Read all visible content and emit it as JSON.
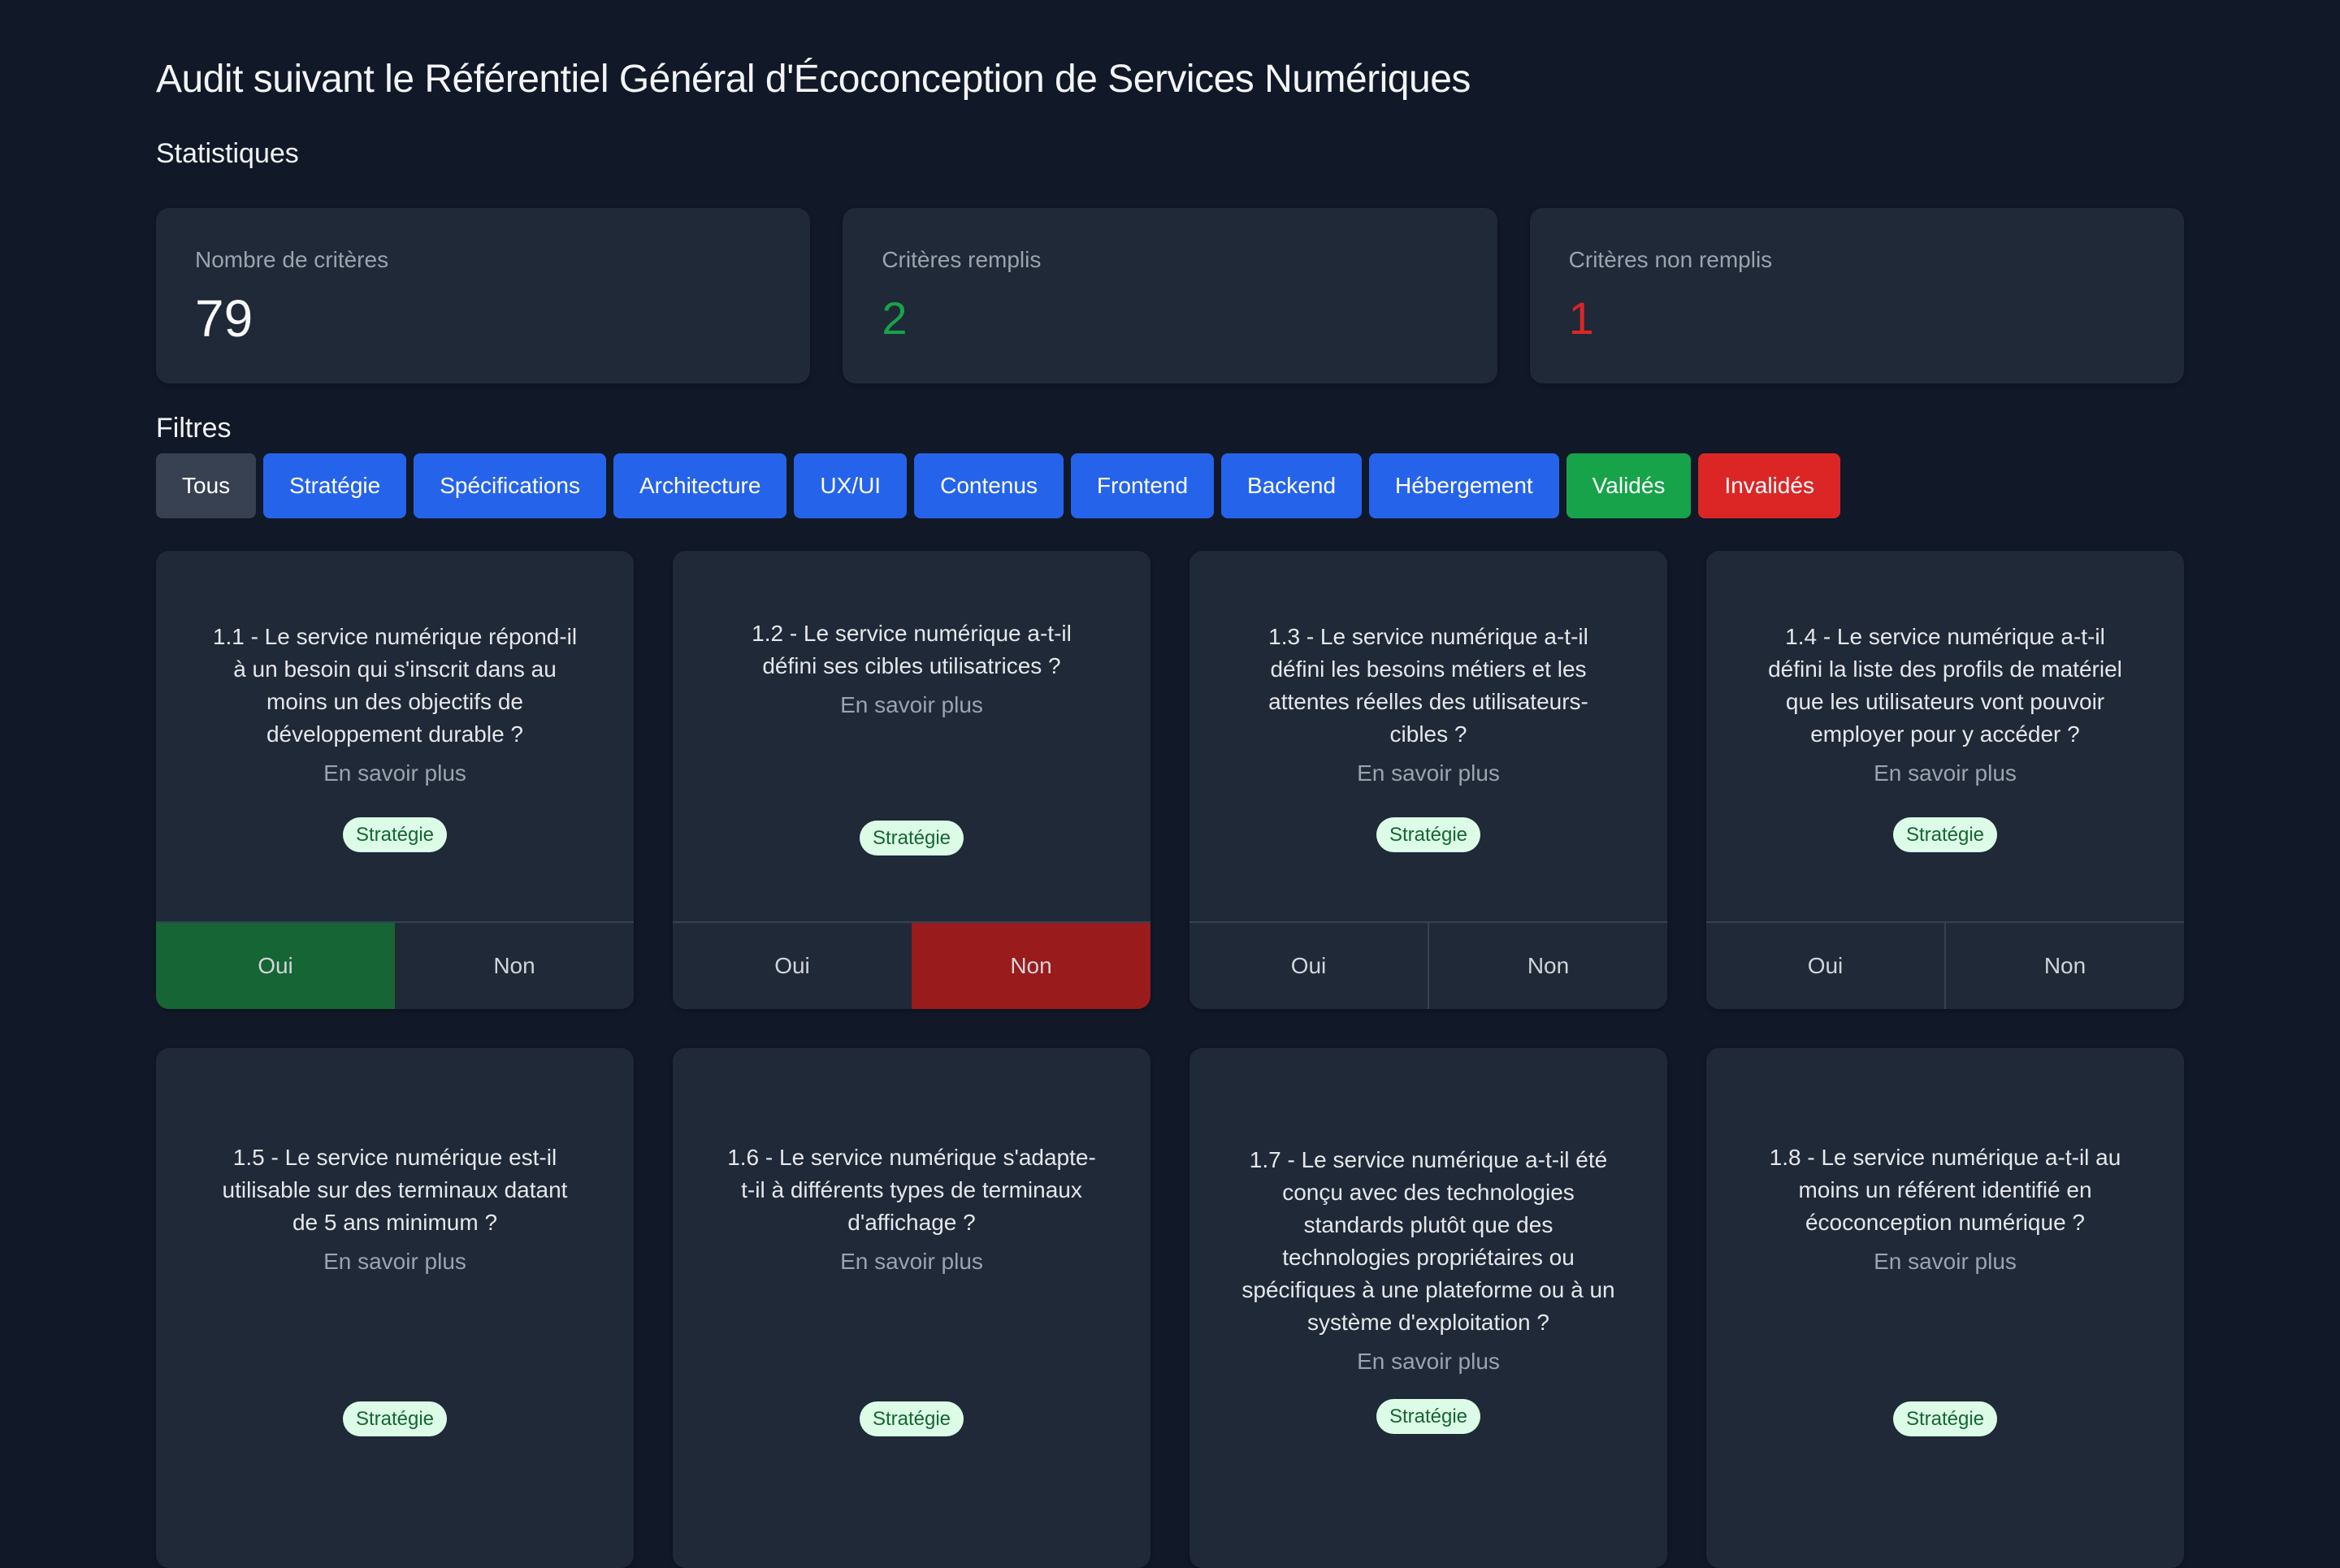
{
  "header": {
    "title": "Audit suivant le Référentiel Général d'Écoconception de Services Numériques"
  },
  "stats": {
    "section_title": "Statistiques",
    "items": [
      {
        "label": "Nombre de critères",
        "value": "79"
      },
      {
        "label": "Critères remplis",
        "value": "2"
      },
      {
        "label": "Critères non remplis",
        "value": "1"
      }
    ]
  },
  "filters": {
    "section_title": "Filtres",
    "buttons": [
      {
        "label": "Tous",
        "style": "neutral"
      },
      {
        "label": "Stratégie",
        "style": "blue"
      },
      {
        "label": "Spécifications",
        "style": "blue"
      },
      {
        "label": "Architecture",
        "style": "blue"
      },
      {
        "label": "UX/UI",
        "style": "blue"
      },
      {
        "label": "Contenus",
        "style": "blue"
      },
      {
        "label": "Frontend",
        "style": "blue"
      },
      {
        "label": "Backend",
        "style": "blue"
      },
      {
        "label": "Hébergement",
        "style": "blue"
      },
      {
        "label": "Validés",
        "style": "green"
      },
      {
        "label": "Invalidés",
        "style": "red"
      }
    ]
  },
  "criteria": {
    "more_label": "En savoir plus",
    "yes_label": "Oui",
    "no_label": "Non",
    "items": [
      {
        "question": "1.1 - Le service numérique répond-il à un besoin qui s'inscrit dans au moins un des objectifs de développement durable ?",
        "tag": "Stratégie",
        "answer": "yes"
      },
      {
        "question": "1.2 - Le service numérique a-t-il défini ses cibles utilisatrices ?",
        "tag": "Stratégie",
        "answer": "no"
      },
      {
        "question": "1.3 - Le service numérique a-t-il défini les besoins métiers et les attentes réelles des utilisateurs-cibles ?",
        "tag": "Stratégie",
        "answer": ""
      },
      {
        "question": "1.4 - Le service numérique a-t-il défini la liste des profils de matériel que les utilisateurs vont pouvoir employer pour y accéder ?",
        "tag": "Stratégie",
        "answer": ""
      },
      {
        "question": "1.5 - Le service numérique est-il utilisable sur des terminaux datant de 5 ans minimum ?",
        "tag": "Stratégie",
        "answer": ""
      },
      {
        "question": "1.6 - Le service numérique s'adapte-t-il à différents types de terminaux d'affichage ?",
        "tag": "Stratégie",
        "answer": ""
      },
      {
        "question": "1.7 - Le service numérique a-t-il été conçu avec des technologies standards plutôt que des technologies propriétaires ou spécifiques à une plateforme ou à un système d'exploitation ?",
        "tag": "Stratégie",
        "answer": ""
      },
      {
        "question": "1.8 - Le service numérique a-t-il au moins un référent identifié en écoconception numérique ?",
        "tag": "Stratégie",
        "answer": ""
      }
    ]
  },
  "colors": {
    "background": "#111827",
    "card": "#1f2937",
    "accent_blue": "#2563eb",
    "success": "#16a34a",
    "danger": "#dc2626",
    "yes_selected": "#166534",
    "no_selected": "#991b1b",
    "badge_bg": "#dcfce7",
    "badge_text": "#166534"
  }
}
